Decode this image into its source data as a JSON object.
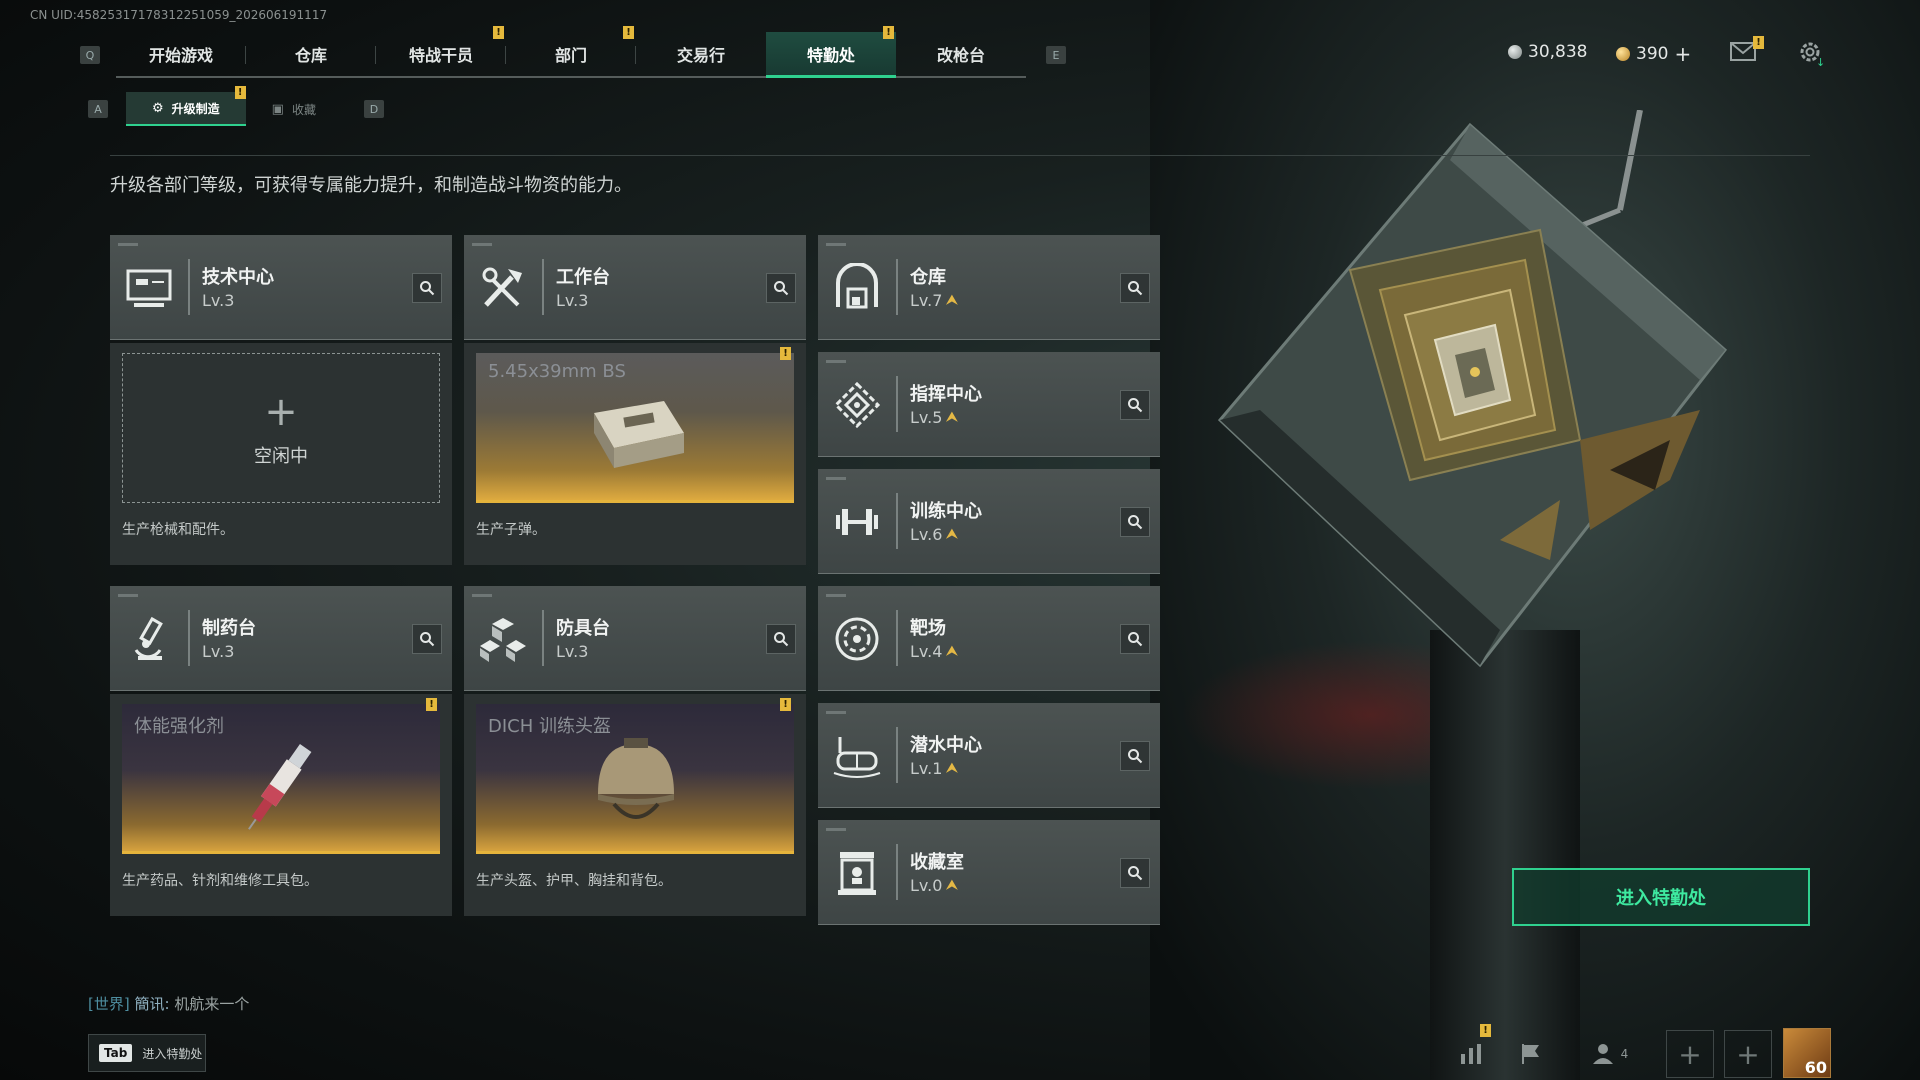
{
  "uid": "CN UID:4582531717831225105­9_202606191117",
  "nav": {
    "left_key": "Q",
    "right_key": "E",
    "tabs": [
      "开始游戏",
      "仓库",
      "特战干员",
      "部门",
      "交易行",
      "特勤处",
      "改枪台"
    ],
    "active": "特勤处",
    "badge": "!"
  },
  "currency": {
    "silver": "30,838",
    "gold": "390",
    "gold_add": "+"
  },
  "subnav": {
    "left_key": "A",
    "right_key": "D",
    "tabs": [
      "升级制造",
      "收藏"
    ],
    "active": "升级制造"
  },
  "description": "升级各部门等级，可获得专属能力提升，和制造战斗物资的能力。",
  "departments": [
    {
      "name": "技术中心",
      "level": "Lv.3",
      "icon": "computer-icon",
      "upgradable": false
    },
    {
      "name": "工作台",
      "level": "Lv.3",
      "icon": "tools-icon",
      "upgradable": false
    },
    {
      "name": "仓库",
      "level": "Lv.7",
      "icon": "warehouse-icon",
      "upgradable": true
    },
    {
      "name": "指挥中心",
      "level": "Lv.5",
      "icon": "command-icon",
      "upgradable": true
    },
    {
      "name": "训练中心",
      "level": "Lv.6",
      "icon": "dumbbell-icon",
      "upgradable": true
    },
    {
      "name": "制药台",
      "level": "Lv.3",
      "icon": "microscope-icon",
      "upgradable": false
    },
    {
      "name": "防具台",
      "level": "Lv.3",
      "icon": "armor-blocks-icon",
      "upgradable": false
    },
    {
      "name": "靶场",
      "level": "Lv.4",
      "icon": "target-icon",
      "upgradable": true
    },
    {
      "name": "潜水中心",
      "level": "Lv.1",
      "icon": "diving-mask-icon",
      "upgradable": true
    },
    {
      "name": "收藏室",
      "level": "Lv.0",
      "icon": "display-case-icon",
      "upgradable": true
    }
  ],
  "production": [
    {
      "state": "idle",
      "label": "空闲中",
      "desc": "生产枪械和配件。"
    },
    {
      "state": "item",
      "item": "5.45x39mm BS",
      "desc": "生产子弹。"
    },
    {
      "state": "item",
      "item": "体能强化剂",
      "desc": "生产药品、针剂和维修工具包。"
    },
    {
      "state": "item",
      "item": "DICH 训练头盔",
      "desc": "生产头盔、护甲、胸挂和背包。"
    }
  ],
  "enter_button": "进入特勤处",
  "chat": {
    "channel": "[世界]",
    "user": "簡讯:",
    "message": "机航来一个"
  },
  "tab_hint": {
    "key": "Tab",
    "label": "进入特勤处"
  },
  "bottom": {
    "friends_count": "4",
    "avatar_level": "60"
  },
  "colors": {
    "accent": "#2fd18f",
    "badge": "#e5b93c",
    "upgrade": "#e4b845"
  }
}
